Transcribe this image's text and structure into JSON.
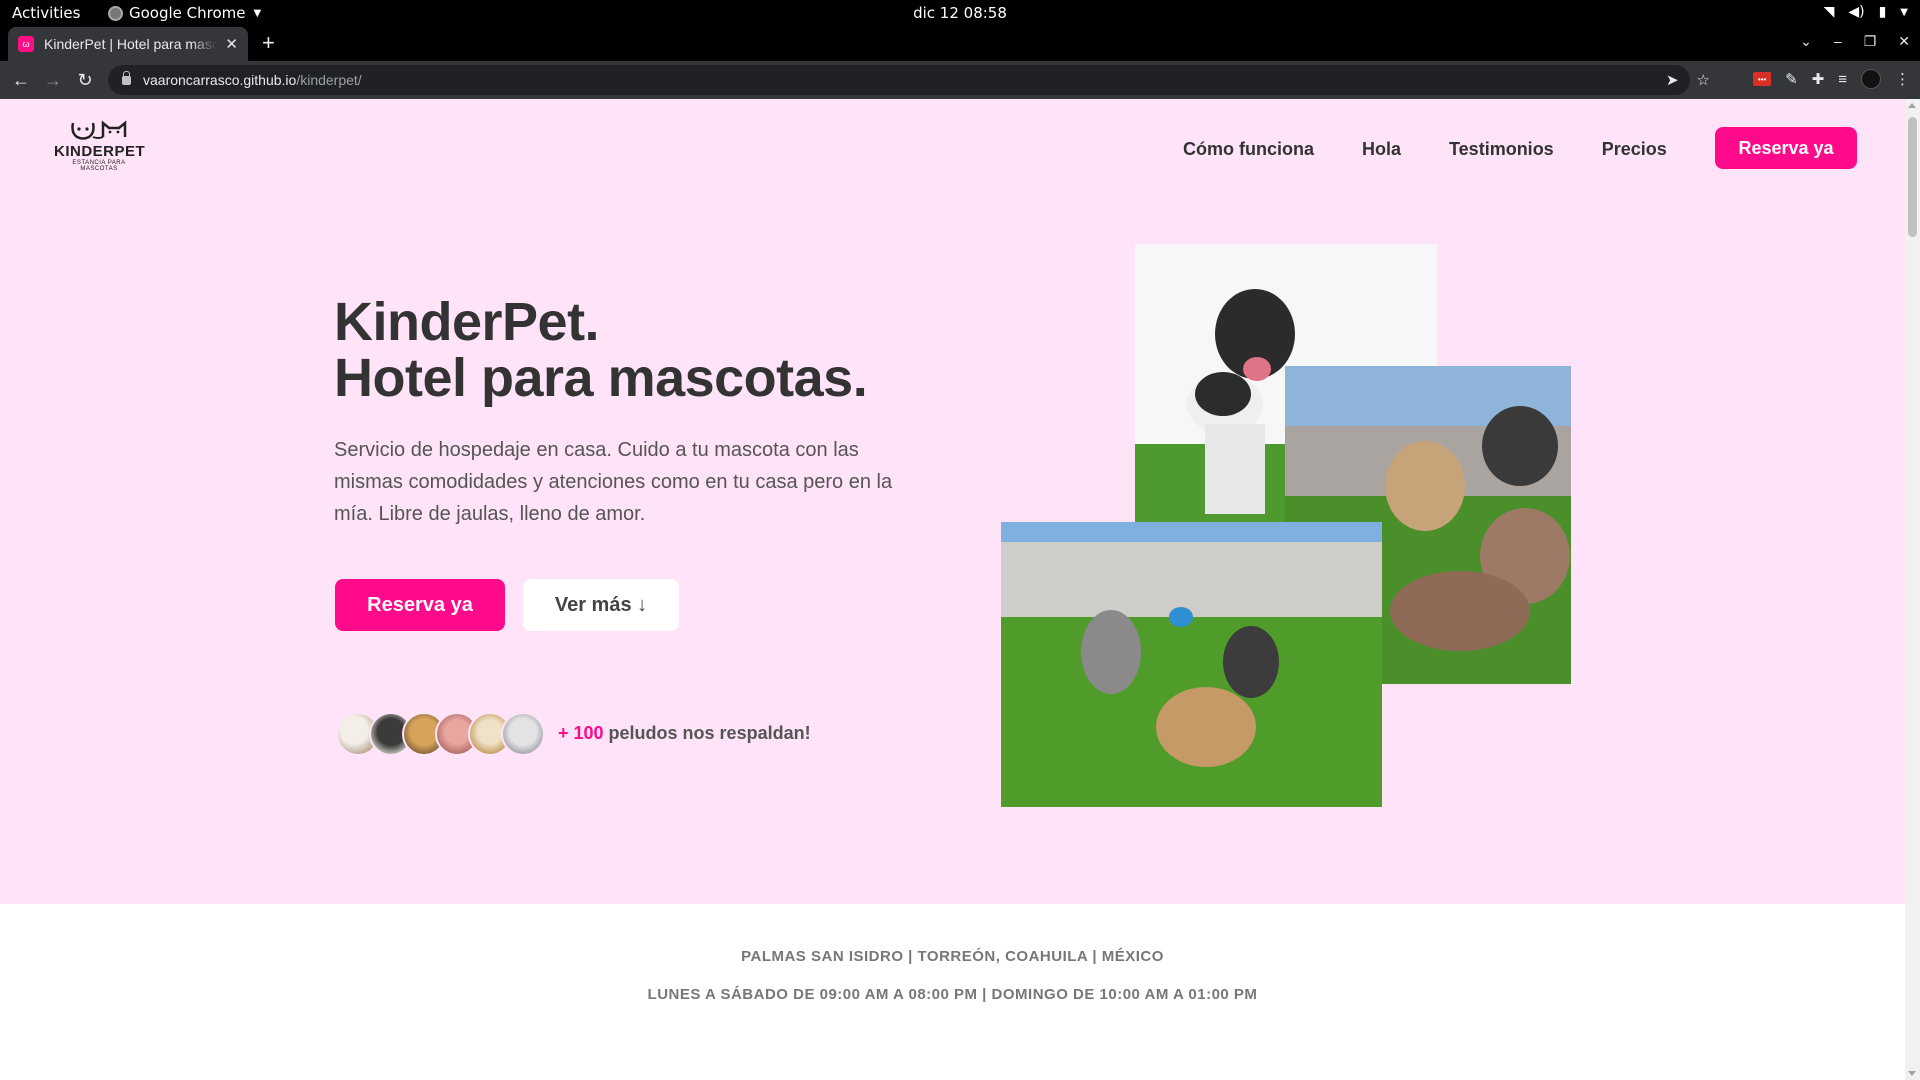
{
  "system": {
    "activities": "Activities",
    "app_name": "Google Chrome",
    "clock": "dic 12  08:58"
  },
  "browser": {
    "tab_title": "KinderPet | Hotel para mascotas",
    "url_domain": "vaaroncarrasco.github.io",
    "url_path": "/kinderpet/"
  },
  "header": {
    "logo_name": "KINDERPET",
    "logo_tagline": "ESTANCIA PARA MASCOTAS",
    "nav": [
      "Cómo funciona",
      "Hola",
      "Testimonios",
      "Precios"
    ],
    "cta": "Reserva ya"
  },
  "hero": {
    "title_line1": "KinderPet.",
    "title_line2": "Hotel para mascotas.",
    "description": "Servicio de hospedaje en casa. Cuido a tu mascota con las mismas comodidades y atenciones como en tu casa pero en la mía. Libre de jaulas, lleno de amor.",
    "primary_button": "Reserva ya",
    "secondary_button": "Ver más ↓",
    "social_count": "+ 100",
    "social_text": " peludos nos respaldan!"
  },
  "info": {
    "location": "PALMAS SAN ISIDRO | TORREÓN, COAHUILA | MÉXICO",
    "hours": "LUNES A SÁBADO DE 09:00 AM A 08:00 PM | DOMINGO DE 10:00 AM A 01:00 PM"
  },
  "colors": {
    "accent": "#ff0a8a",
    "hero_background": "#ffe4f9",
    "text_dark": "#333333"
  }
}
